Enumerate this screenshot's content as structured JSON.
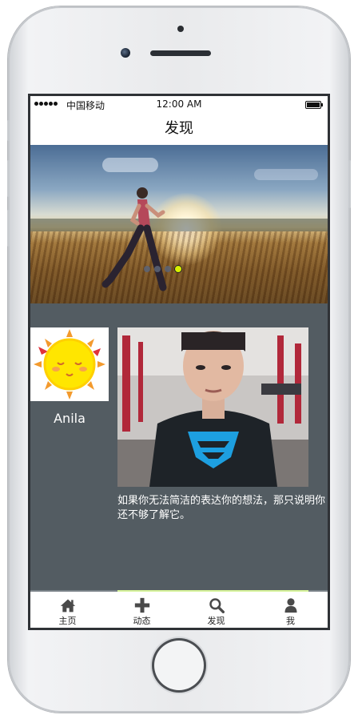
{
  "status_bar": {
    "carrier": "中国移动",
    "time": "12:00 AM"
  },
  "nav": {
    "title": "发现"
  },
  "banner": {
    "slide_count": 4,
    "active_index": 3
  },
  "profile": {
    "name": "Anila",
    "avatar_icon": "sun-cartoon-icon"
  },
  "post": {
    "text": "如果你无法简洁的表达你的想法，那只说明你还不够了解它。",
    "image_icon": "superman-shirt-man-photo"
  },
  "tabs": [
    {
      "label": "主页",
      "icon": "home-icon"
    },
    {
      "label": "动态",
      "icon": "plus-icon"
    },
    {
      "label": "发现",
      "icon": "search-icon"
    },
    {
      "label": "我",
      "icon": "user-icon"
    }
  ],
  "colors": {
    "screen_bg": "#535c62",
    "active_dot": "#d8f000",
    "tab_icon": "#4a4a4a"
  }
}
